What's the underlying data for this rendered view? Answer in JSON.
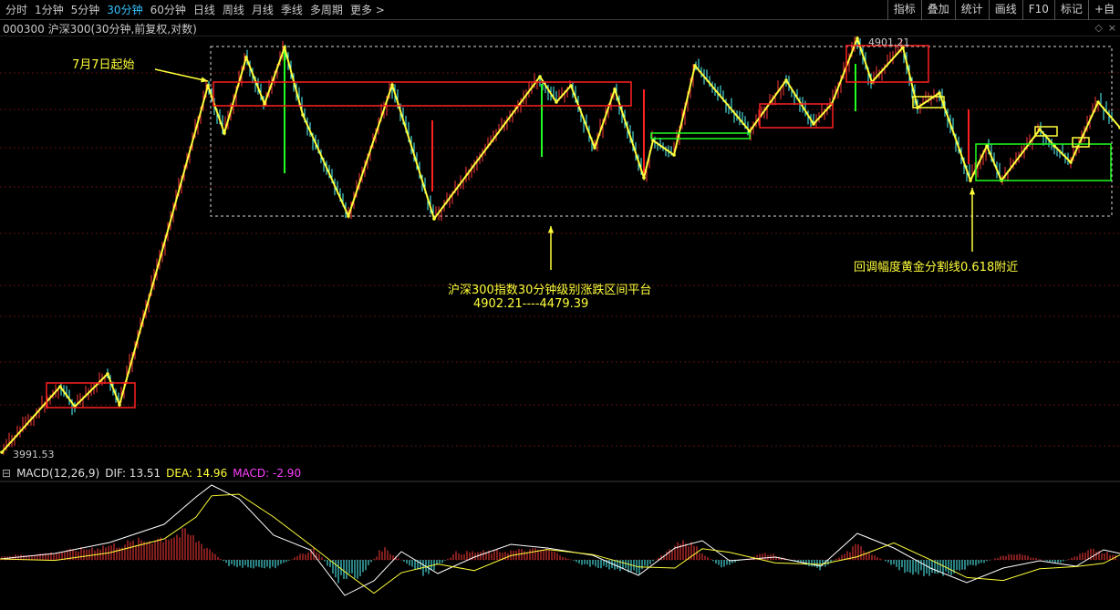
{
  "toolbar": {
    "periods": [
      "分时",
      "1分钟",
      "5分钟",
      "30分钟",
      "60分钟",
      "日线",
      "周线",
      "月线",
      "季线",
      "多周期",
      "更多 >"
    ],
    "active_period_index": 3,
    "buttons": [
      "指标",
      "叠加",
      "统计",
      "画线",
      "F10",
      "标记",
      "+自"
    ]
  },
  "chart": {
    "title": "000300 沪深300(30分钟,前复权,对数)",
    "high_label": "4901.21",
    "low_label": "3991.53"
  },
  "annotations": {
    "start_note": "7月7日起始",
    "platform_line1": "沪深300指数30分钟级别涨跌区间平台",
    "platform_line2": "4902.21----4479.39",
    "retrace_note": "回调幅度黄金分割线0.618附近"
  },
  "macd": {
    "name": "MACD(12,26,9)",
    "dif_text": "DIF: 13.51",
    "dea_text": "DEA: 14.96",
    "macd_text": "MACD: -2.90"
  },
  "colors": {
    "up": "#ff3b3b",
    "down": "#54ffff",
    "zigzag": "#ffff3a",
    "box_red": "#ff2020",
    "box_green": "#20ff20",
    "box_yellow": "#ffff3a",
    "platform_box": "#d8d8d8",
    "dif_line": "#ffffff",
    "dea_line": "#ffff3a"
  }
}
